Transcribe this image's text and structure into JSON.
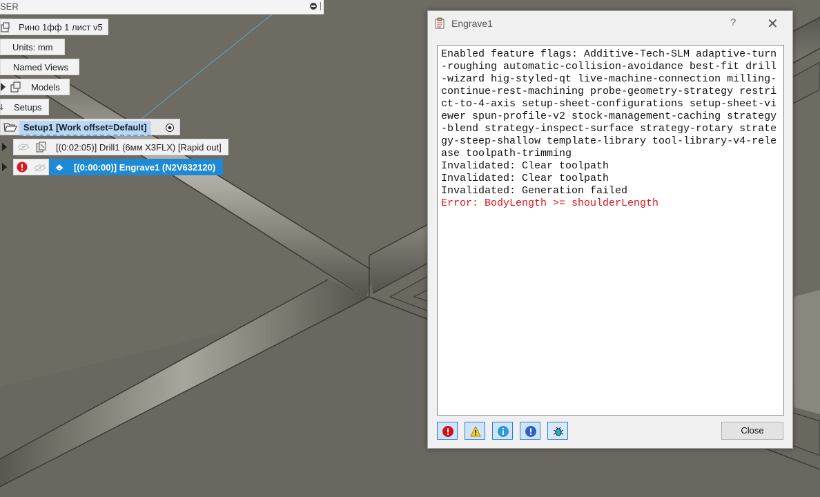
{
  "browser": {
    "header_title": "SER",
    "document": "Рино 1фф 1 лист v5",
    "units": "Units: mm",
    "named_views": "Named Views",
    "models": "Models",
    "setups": "Setups",
    "setup1": "Setup1 [Work offset=Default]",
    "ops": [
      {
        "label": "[(0:02:05)] Drill1 (6мм X3FLX) [Rapid out]",
        "icon": "drill-icon",
        "status": "ok"
      },
      {
        "label": "[(0:00:00)] Engrave1 (N2V632120)",
        "icon": "engrave-icon",
        "status": "error"
      }
    ]
  },
  "dialog": {
    "title": "Engrave1",
    "help": "?",
    "close_x": "✕",
    "log_lines": [
      "Enabled feature flags: Additive-Tech-SLM adaptive-turn-roughing automatic-collision-avoidance best-fit drill-wizard hig-styled-qt live-machine-connection milling-continue-rest-machining probe-geometry-strategy restrict-to-4-axis setup-sheet-configurations setup-sheet-viewer spun-profile-v2 stock-management-caching strategy-blend strategy-inspect-surface strategy-rotary strategy-steep-shallow template-library tool-library-v4-release toolpath-trimming",
      "Invalidated: Clear toolpath",
      "Invalidated: Clear toolpath",
      "Invalidated: Generation failed"
    ],
    "error_line": "Error: BodyLength >= shoulderLength",
    "filters": [
      "error-filter-icon",
      "warning-filter-icon",
      "info-filter-icon",
      "debug-info-filter-icon",
      "bug-filter-icon"
    ],
    "close_label": "Close"
  },
  "colors": {
    "error": "#e0141e",
    "selection": "#1e8ad6",
    "setup_highlight": "#bcd7f2"
  }
}
